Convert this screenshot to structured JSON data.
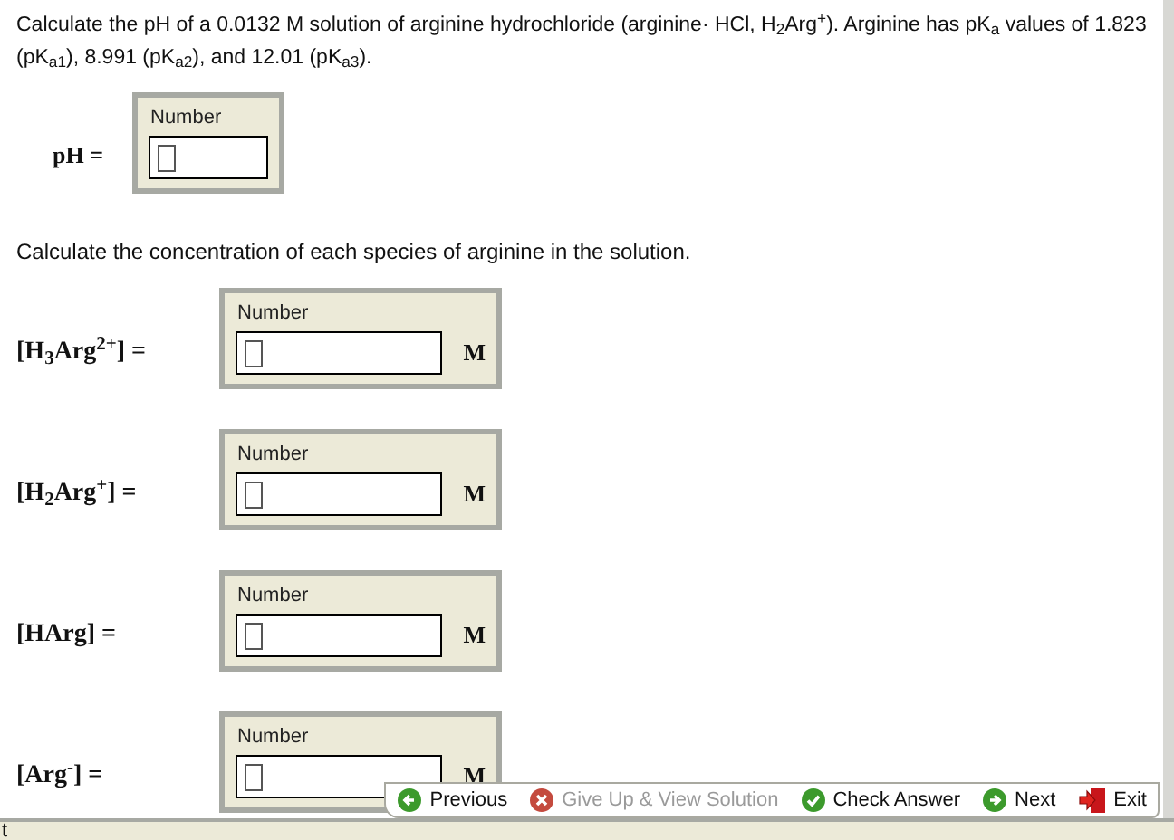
{
  "question": "Calculate the pH of a 0.0132 M solution of arginine hydrochloride (arginine· HCl, H$_{2}$Arg$^{+}$). Arginine has pK$_{a}$ values of 1.823 (pK$_{a1}$), 8.991 (pK$_{a2}$), and 12.01 (pK$_{a3}$).",
  "ph_answer": {
    "label": "pH =",
    "box_label": "Number"
  },
  "instruction": "Calculate the concentration of each species of arginine in the solution.",
  "species": [
    {
      "label": "[H$_{3}$Arg$^{2+}$] =",
      "box_label": "Number",
      "unit": "M"
    },
    {
      "label": "[H$_{2}$Arg$^{+}$] =",
      "box_label": "Number",
      "unit": "M"
    },
    {
      "label": "[HArg] =",
      "box_label": "Number",
      "unit": "M"
    },
    {
      "label": "[Arg$^{-}$] =",
      "box_label": "Number",
      "unit": "M"
    }
  ],
  "nav": [
    {
      "kind": "previous",
      "label": "Previous",
      "disabled": false
    },
    {
      "kind": "give_up",
      "label": "Give Up & View Solution",
      "disabled": true
    },
    {
      "kind": "check",
      "label": "Check Answer",
      "disabled": false
    },
    {
      "kind": "next",
      "label": "Next",
      "disabled": false
    },
    {
      "kind": "exit",
      "label": "Exit",
      "disabled": false
    }
  ],
  "status_bar": {
    "text": "t"
  }
}
